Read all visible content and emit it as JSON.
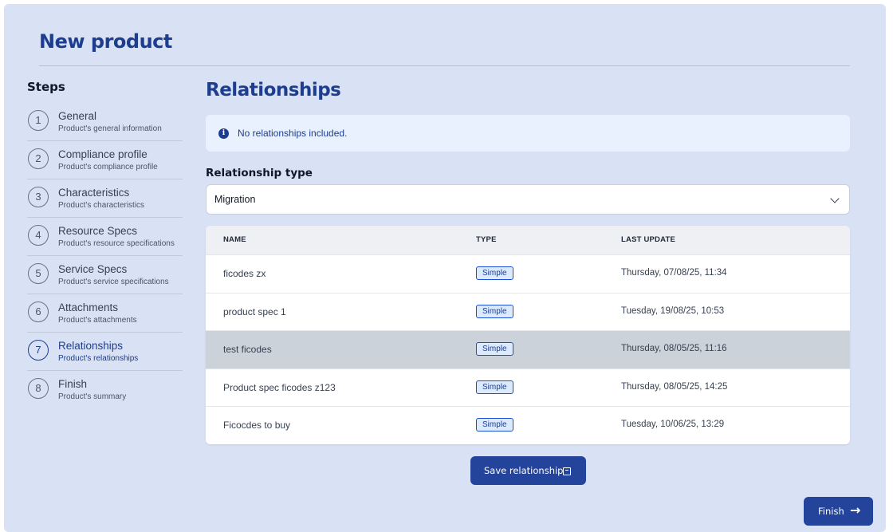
{
  "page": {
    "title": "New product"
  },
  "steps": {
    "title": "Steps",
    "items": [
      {
        "num": "1",
        "label": "General",
        "sub": "Product's general information"
      },
      {
        "num": "2",
        "label": "Compliance profile",
        "sub": "Product's compliance profile"
      },
      {
        "num": "3",
        "label": "Characteristics",
        "sub": "Product's characteristics"
      },
      {
        "num": "4",
        "label": "Resource Specs",
        "sub": "Product's resource specifications"
      },
      {
        "num": "5",
        "label": "Service Specs",
        "sub": "Product's service specifications"
      },
      {
        "num": "6",
        "label": "Attachments",
        "sub": "Product's attachments"
      },
      {
        "num": "7",
        "label": "Relationships",
        "sub": "Product's relationships"
      },
      {
        "num": "8",
        "label": "Finish",
        "sub": "Product's summary"
      }
    ],
    "active_index": 6
  },
  "main": {
    "title": "Relationships",
    "info": {
      "icon": "info-icon",
      "text": "No relationships included."
    },
    "relationship_type": {
      "label": "Relationship type",
      "value": "Migration"
    },
    "table": {
      "headers": {
        "name": "NAME",
        "type": "TYPE",
        "last_update": "LAST UPDATE"
      },
      "rows": [
        {
          "name": "ficodes zx",
          "type": "Simple",
          "last_update": "Thursday, 07/08/25, 11:34"
        },
        {
          "name": "product spec 1",
          "type": "Simple",
          "last_update": "Tuesday, 19/08/25, 10:53"
        },
        {
          "name": "test ficodes",
          "type": "Simple",
          "last_update": "Thursday, 08/05/25, 11:16"
        },
        {
          "name": "Product spec ficodes z123",
          "type": "Simple",
          "last_update": "Thursday, 08/05/25, 14:25"
        },
        {
          "name": "Ficocdes to buy",
          "type": "Simple",
          "last_update": "Tuesday, 10/06/25, 13:29"
        }
      ],
      "highlighted_row": 2
    },
    "save_button": {
      "label": "Save relationship",
      "icon": "save-icon"
    }
  },
  "finish_button": {
    "label": "Finish",
    "icon": "arrow-right-icon"
  },
  "colors": {
    "accent": "#1d3d8f",
    "background": "#d8e2f4",
    "button": "#24439a",
    "highlight_row": "#ccd2d9"
  }
}
